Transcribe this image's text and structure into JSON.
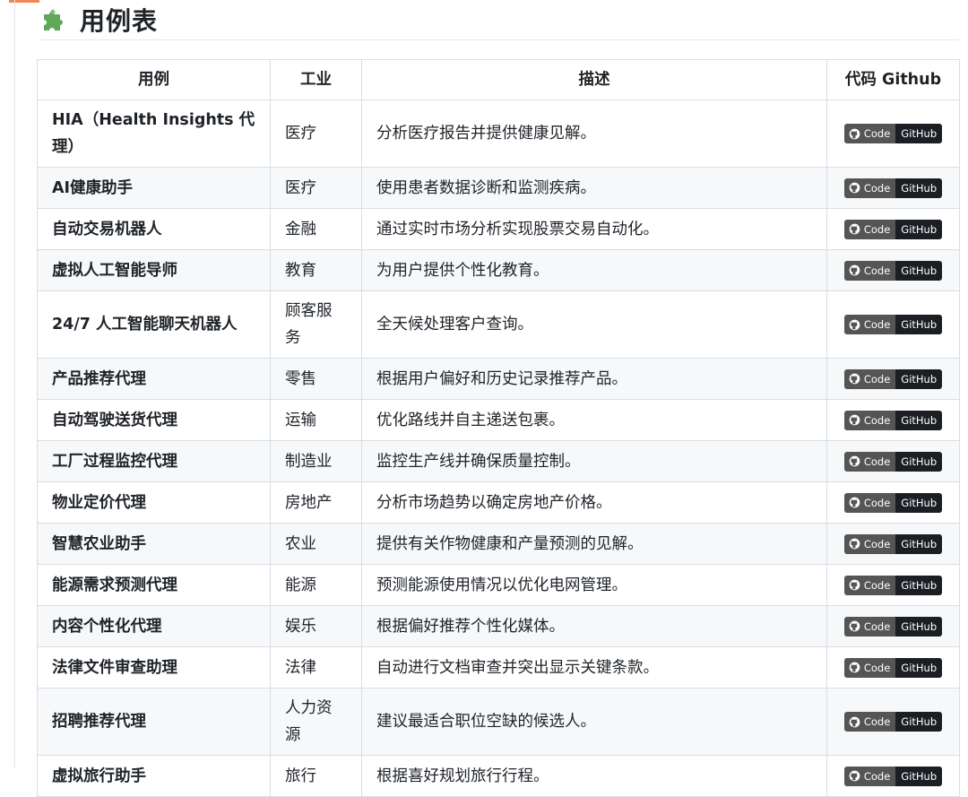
{
  "title": "用例表",
  "table": {
    "headers": [
      "用例",
      "工业",
      "描述",
      "代码 Github"
    ],
    "badge": {
      "left": "Code",
      "right": "GitHub"
    },
    "rows": [
      {
        "usecase": "HIA（Health Insights 代理）",
        "industry": "医疗",
        "description": "分析医疗报告并提供健康见解。"
      },
      {
        "usecase": "AI健康助手",
        "industry": "医疗",
        "description": "使用患者数据诊断和监测疾病。"
      },
      {
        "usecase": "自动交易机器人",
        "industry": "金融",
        "description": "通过实时市场分析实现股票交易自动化。"
      },
      {
        "usecase": "虚拟人工智能导师",
        "industry": "教育",
        "description": "为用户提供个性化教育。"
      },
      {
        "usecase": "24/7 人工智能聊天机器人",
        "industry": "顾客服务",
        "description": "全天候处理客户查询。"
      },
      {
        "usecase": "产品推荐代理",
        "industry": "零售",
        "description": "根据用户偏好和历史记录推荐产品。"
      },
      {
        "usecase": "自动驾驶送货代理",
        "industry": "运输",
        "description": "优化路线并自主递送包裹。"
      },
      {
        "usecase": "工厂过程监控代理",
        "industry": "制造业",
        "description": "监控生产线并确保质量控制。"
      },
      {
        "usecase": "物业定价代理",
        "industry": "房地产",
        "description": "分析市场趋势以确定房地产价格。"
      },
      {
        "usecase": "智慧农业助手",
        "industry": "农业",
        "description": "提供有关作物健康和产量预测的见解。"
      },
      {
        "usecase": "能源需求预测代理",
        "industry": "能源",
        "description": "预测能源使用情况以优化电网管理。"
      },
      {
        "usecase": "内容个性化代理",
        "industry": "娱乐",
        "description": "根据偏好推荐个性化媒体。"
      },
      {
        "usecase": "法律文件审查助理",
        "industry": "法律",
        "description": "自动进行文档审查并突出显示关键条款。"
      },
      {
        "usecase": "招聘推荐代理",
        "industry": "人力资源",
        "description": "建议最适合职位空缺的候选人。"
      },
      {
        "usecase": "虚拟旅行助手",
        "industry": "旅行",
        "description": "根据喜好规划旅行行程。"
      }
    ]
  },
  "colors": {
    "zebra": "#f6f8fa",
    "border": "#d8dee4",
    "badge_left": "#555555",
    "badge_right": "#1b1f24",
    "puzzle_green": "#5fa85a"
  },
  "icons": {
    "heading": "puzzle-piece-icon",
    "badge": "github-icon"
  }
}
